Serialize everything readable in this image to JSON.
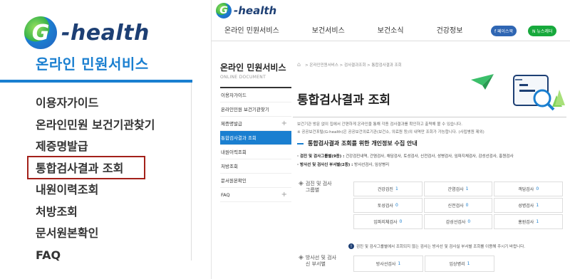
{
  "zoom": {
    "logo_text": "-health",
    "title": "온라인 민원서비스",
    "menu": [
      "이용자가이드",
      "온라인민원 보건기관찾기",
      "제증명발급",
      "통합검사결과 조회",
      "내원이력조회",
      "처방조회",
      "문서원본확인",
      "FAQ"
    ]
  },
  "header": {
    "logo_text": "-health",
    "nav": [
      "온라인 민원서비스",
      "보건서비스",
      "보건소식",
      "건강정보"
    ],
    "facebook": "f 페이스북",
    "newsletter": "N 뉴스레터"
  },
  "sidebar": {
    "title": "온라인 민원서비스",
    "subtitle": "ONLINE DOCUMENT",
    "items": [
      {
        "label": "이용자가이드",
        "plus": ""
      },
      {
        "label": "온라인민원 보건기관찾기",
        "plus": ""
      },
      {
        "label": "제증명발급",
        "plus": "+"
      },
      {
        "label": "통합검사결과 조회",
        "plus": ""
      },
      {
        "label": "내원이력조회",
        "plus": ""
      },
      {
        "label": "처방조회",
        "plus": ""
      },
      {
        "label": "문서원본확인",
        "plus": ""
      },
      {
        "label": "FAQ",
        "plus": "+"
      }
    ]
  },
  "content": {
    "breadcrumb": "> 온라인민원서비스 > 검사결과조회 > 통합검사결과 조회",
    "title": "통합검사결과 조회",
    "desc1": "보건기관 방문 없이 집에서 간편하게 온라인을 통해 각종 검사결과를 확인하고 출력해 볼 수 있습니다.",
    "desc2": "※ 공공보건포털(G-health)은 공공보건의료기관(보건소, 의료원 등)의 내역만 조회가 가능합니다. (사립병원 제외)",
    "section_title": "통합검사결과 조회를 위한 개인정보 수집 안내",
    "bullet1_label": "· 검진 및 검사그룹별(9종) :",
    "bullet1_text": " 건강검진내역, 간염검사, 채담검사, 토성검사, 신전검사, 성병검사, 임파지체검사, 감성선검사, 홍원검사",
    "bullet2_label": "· 방사선 및 검사신 부서별(2종) :",
    "bullet2_text": " 방사선검사, 임상병리",
    "groupA_label": "검진 및 검사그룹별",
    "groupA": [
      [
        {
          "name": "건강검진",
          "v": "1"
        },
        {
          "name": "간염검사",
          "v": "1"
        },
        {
          "name": "객담검사",
          "v": "0"
        }
      ],
      [
        {
          "name": "토성검사",
          "v": "0"
        },
        {
          "name": "신전검사",
          "v": "0"
        },
        {
          "name": "성병검사",
          "v": "1"
        }
      ],
      [
        {
          "name": "임파지체검사",
          "v": "0"
        },
        {
          "name": "감성선검사",
          "v": "0"
        },
        {
          "name": "홍원검사",
          "v": "1"
        }
      ]
    ],
    "note": "검진 및 검사그룹별에서 조회되지 않는 검사는 방사선 및 검사실 부서별 조회를 이용해 주시기 바랍니다.",
    "groupB_label": "방사선 및 검사신 부서별",
    "groupB": [
      {
        "name": "방사선검사",
        "v": "1"
      },
      {
        "name": "임상병리",
        "v": "1"
      }
    ]
  }
}
